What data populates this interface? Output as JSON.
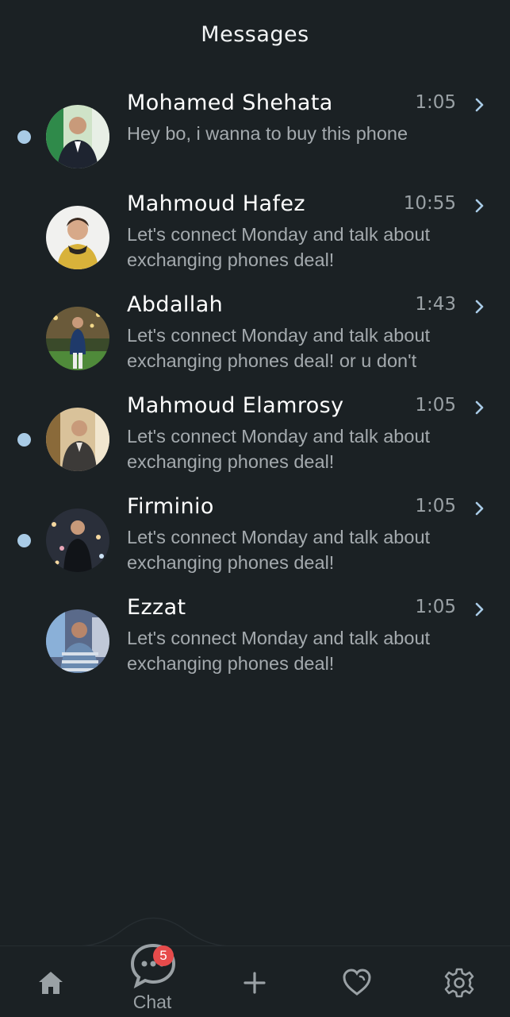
{
  "header": {
    "title": "Messages"
  },
  "conversations": [
    {
      "name": "Mohamed Shehata",
      "time": "1:05",
      "preview": "Hey bo, i wanna to buy this phone",
      "unread": true
    },
    {
      "name": "Mahmoud Hafez",
      "time": "10:55",
      "preview": "Let's connect Monday and talk about exchanging phones deal!",
      "unread": false
    },
    {
      "name": "Abdallah",
      "time": "1:43",
      "preview": "Let's connect Monday and talk about exchanging phones deal! or u don't",
      "unread": false
    },
    {
      "name": "Mahmoud Elamrosy",
      "time": "1:05",
      "preview": "Let's connect Monday and talk about exchanging phones deal!",
      "unread": true
    },
    {
      "name": "Firminio",
      "time": "1:05",
      "preview": "Let's connect Monday and talk about exchanging phones deal!",
      "unread": true
    },
    {
      "name": "Ezzat",
      "time": "1:05",
      "preview": "Let's connect Monday and talk about exchanging phones deal!",
      "unread": false
    }
  ],
  "bottom_nav": {
    "items": [
      {
        "icon": "home-icon"
      },
      {
        "icon": "chat-icon",
        "label": "Chat",
        "badge": "5"
      },
      {
        "icon": "plus-icon"
      },
      {
        "icon": "heart-icon"
      },
      {
        "icon": "settings-icon"
      }
    ]
  },
  "colors": {
    "background": "#1b2124",
    "unread_dot": "#a9cbe6",
    "chevron": "#a9cbe6",
    "badge": "#e64b4b"
  }
}
